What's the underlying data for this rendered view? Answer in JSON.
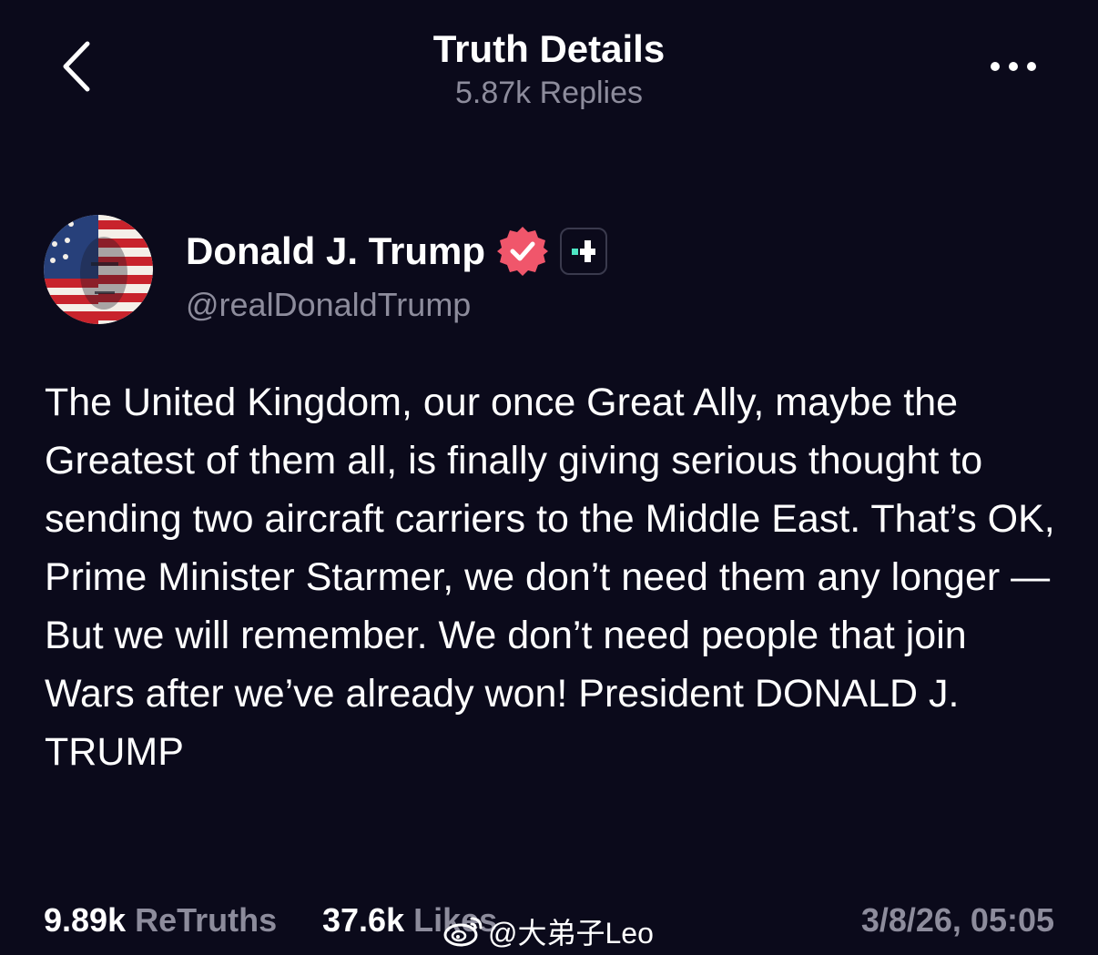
{
  "header": {
    "title": "Truth Details",
    "subtitle": "5.87k Replies",
    "back_icon": "chevron-left-icon",
    "more_icon": "more-horizontal-icon"
  },
  "author": {
    "name": "Donald J. Trump",
    "handle": "@realDonaldTrump",
    "verified_icon": "verified-badge-icon",
    "plus_icon": "truth-plus-icon",
    "colors": {
      "verified": "#f0566b",
      "plus_accent": "#4ee6c4"
    }
  },
  "post": {
    "text": "The United Kingdom, our once Great Ally, maybe the Greatest of them all, is finally giving serious thought to sending two aircraft carriers to the Middle East. That’s OK, Prime Minister Starmer, we don’t need them any longer — But we will remember. We don’t need people that join Wars after we’ve already won! President DONALD J. TRUMP"
  },
  "stats": {
    "retruths_count": "9.89k",
    "retruths_label": "ReTruths",
    "likes_count": "37.6k",
    "likes_label": "Likes",
    "timestamp": "3/8/26, 05:05"
  },
  "watermark": {
    "text": "@大弟子Leo",
    "icon": "weibo-icon"
  },
  "colors": {
    "background": "#0b0a1b",
    "primary_text": "#ffffff",
    "secondary_text": "#8d8c9c"
  }
}
